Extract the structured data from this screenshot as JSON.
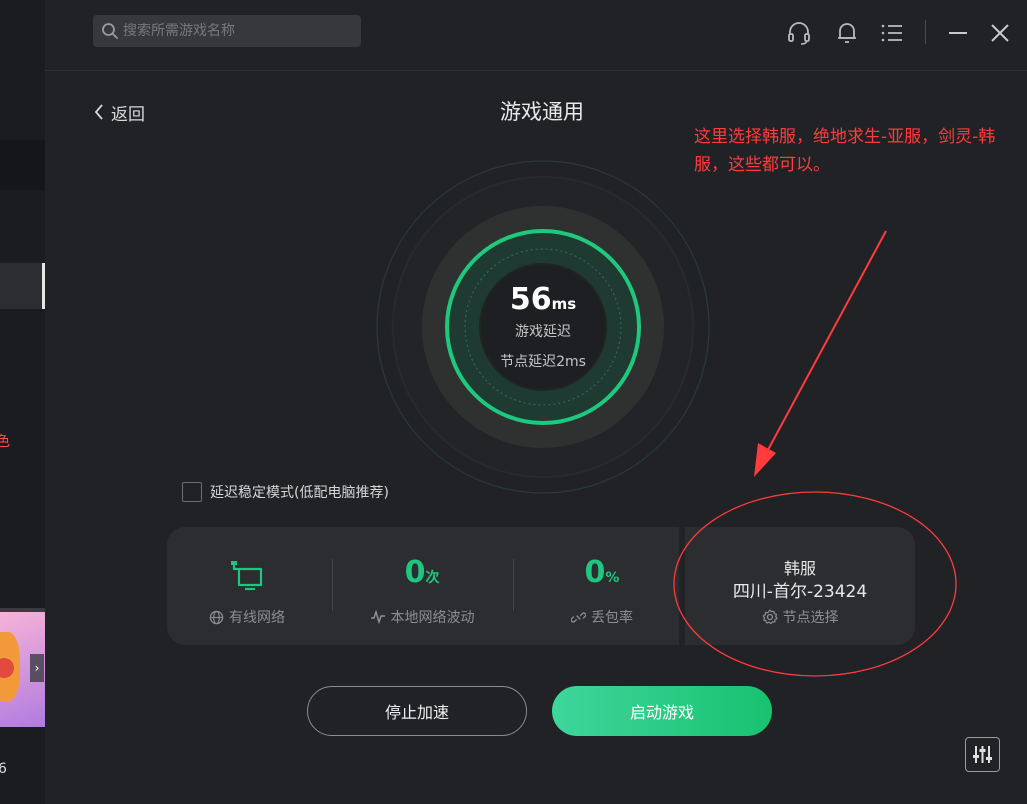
{
  "search": {
    "placeholder": "搜索所需游戏名称"
  },
  "header": {
    "back_label": "返回",
    "title": "游戏通用"
  },
  "annotation": {
    "text": "这里选择韩服，绝地求生-亚服，剑灵-韩服，这些都可以。",
    "color": "#ff3b3b"
  },
  "gauge": {
    "latency_value": "56",
    "latency_unit": "ms",
    "latency_label": "游戏延迟",
    "node_latency": "节点延迟2ms"
  },
  "stable_mode": {
    "label": "延迟稳定模式(低配电脑推荐)",
    "checked": false
  },
  "stats": {
    "network_label": "有线网络",
    "fluctuation_value": "0",
    "fluctuation_unit": "次",
    "fluctuation_label": "本地网络波动",
    "loss_value": "0",
    "loss_unit": "%",
    "loss_label": "丢包率"
  },
  "node_card": {
    "server": "韩服",
    "node": "四川-首尔-23424",
    "select_label": "节点选择"
  },
  "buttons": {
    "stop": "停止加速",
    "start": "启动游戏"
  },
  "left_strip": {
    "red_char": "色",
    "bottom_text": "6"
  },
  "colors": {
    "accent_green": "#1fc77e",
    "background": "#212226",
    "panel": "#2c2d31"
  }
}
